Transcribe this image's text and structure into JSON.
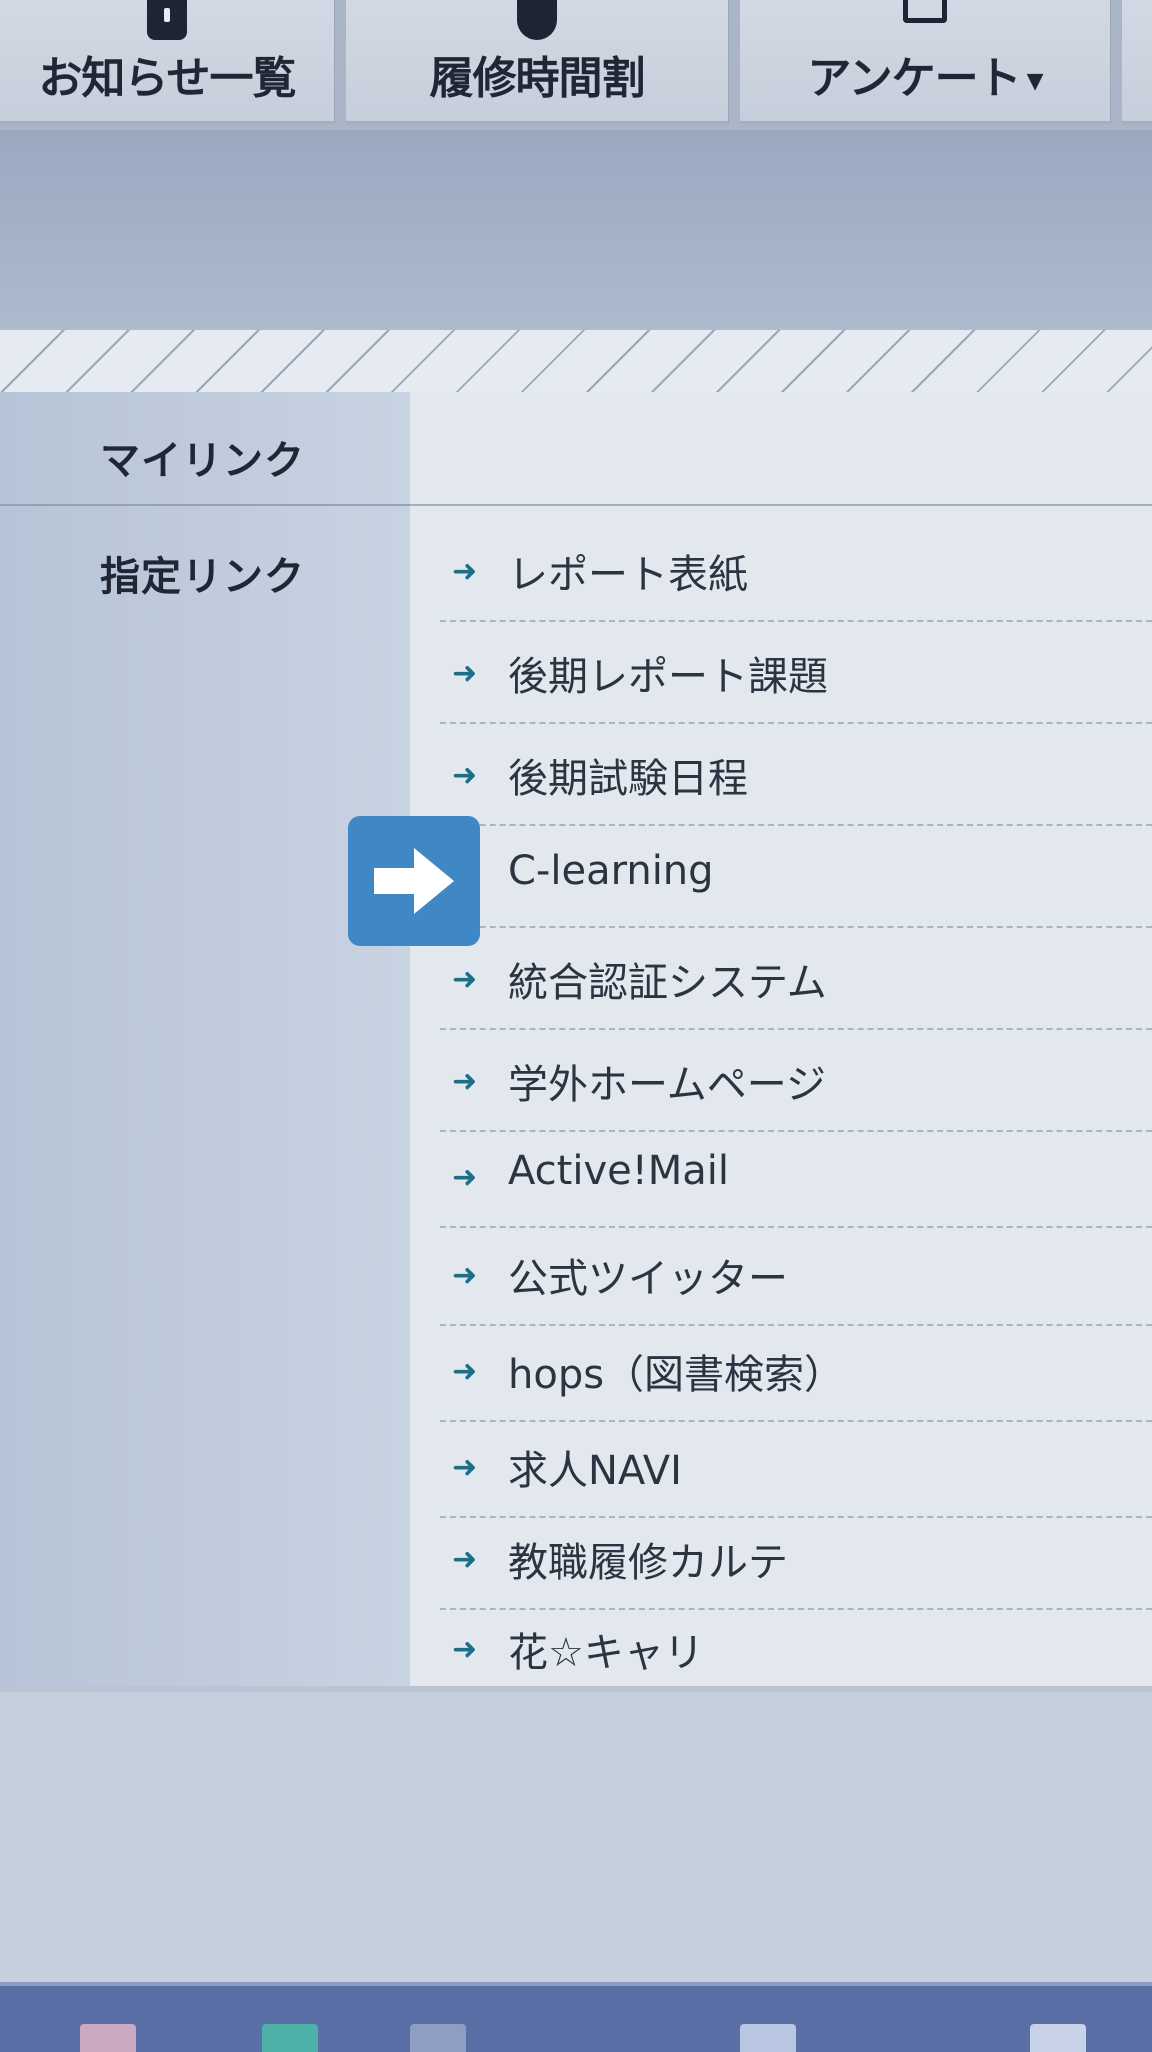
{
  "nav": {
    "items": [
      {
        "label": "お知らせ一覧"
      },
      {
        "label": "履修時間割"
      },
      {
        "label": "アンケート"
      }
    ]
  },
  "mylink": {
    "heading": "マイリンク"
  },
  "designated": {
    "heading": "指定リンク",
    "links": [
      {
        "label": "レポート表紙"
      },
      {
        "label": "後期レポート課題"
      },
      {
        "label": "後期試験日程"
      },
      {
        "label": "C-learning"
      },
      {
        "label": "統合認証システム"
      },
      {
        "label": "学外ホームページ"
      },
      {
        "label": "Active!Mail"
      },
      {
        "label": "公式ツイッター"
      },
      {
        "label": "hops（図書検索）"
      },
      {
        "label": "求人NAVI"
      },
      {
        "label": "教職履修カルテ"
      },
      {
        "label": "花☆キャリ"
      }
    ]
  },
  "colors": {
    "accent_arrow_button": "#3f88c5",
    "link_arrow": "#1c6f86",
    "taskbar": "#5a6fa5"
  },
  "icons": {
    "nav_0": "info-icon",
    "nav_1": "clock-icon",
    "nav_2": "survey-icon",
    "link_bullet": "arrow-right-icon",
    "overlay": "arrow-right-icon"
  }
}
